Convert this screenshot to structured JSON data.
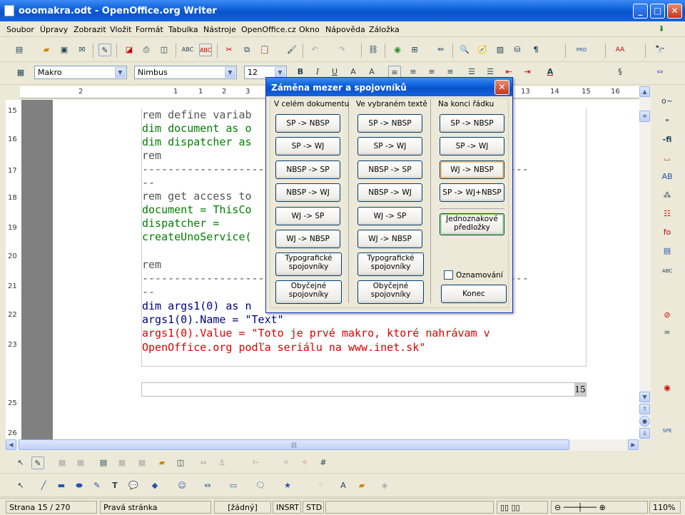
{
  "window": {
    "title": "ooomakra.odt - OpenOffice.org Writer"
  },
  "menu": [
    "Soubor",
    "Úpravy",
    "Zobrazit",
    "Vložit",
    "Formát",
    "Tabulka",
    "Nástroje",
    "OpenOffice.cz",
    "Okno",
    "Nápověda",
    "Záložka"
  ],
  "format_bar": {
    "style": "Makro",
    "font": "Nimbus",
    "size": "12"
  },
  "ruler": {
    "h_ticks": [
      "2",
      "1",
      "1",
      "2",
      "3",
      "4",
      "5",
      "13",
      "14",
      "15",
      "16"
    ],
    "v_ticks": [
      "15",
      "16",
      "17",
      "18",
      "19",
      "20",
      "21",
      "22",
      "23",
      "25",
      "26"
    ]
  },
  "document": {
    "lines": [
      {
        "text": "rem define variab",
        "cls": "c-gray"
      },
      {
        "text": "dim document as o",
        "cls": "c-green"
      },
      {
        "text": "dim dispatcher as",
        "cls": "c-green"
      },
      {
        "text": "rem",
        "cls": "c-gray"
      },
      {
        "text": "------------------------------------------------------------",
        "cls": "c-gray"
      },
      {
        "text": "--",
        "cls": "c-gray"
      },
      {
        "text": "rem get access to",
        "cls": "c-gray"
      },
      {
        "text": "document = ThisCo",
        "cls": "c-green"
      },
      {
        "text": "dispatcher =",
        "cls": "c-green"
      },
      {
        "text": "createUnoService(                                    r\")",
        "cls": "c-green"
      },
      {
        "text": "",
        "cls": "c-gray"
      },
      {
        "text": "rem",
        "cls": "c-gray"
      },
      {
        "text": "------------------------------------------------------------",
        "cls": "c-gray"
      },
      {
        "text": "--",
        "cls": "c-gray"
      },
      {
        "text": "dim args1(0) as n                                   ue",
        "cls": "c-navy"
      },
      {
        "text": "args1(0).Name = \"Text\"",
        "cls": "c-navy"
      },
      {
        "text": "args1(0).Value = \"Toto je prvé makro, ktoré nahrávam v",
        "cls": "c-red"
      },
      {
        "text": "OpenOffice.org podľa seriálu na www.inet.sk\"",
        "cls": "c-red"
      }
    ],
    "footer_page_number": "15"
  },
  "dialog": {
    "title": "Záměna mezer a spojovníků",
    "col1_header": "V celém dokumentu",
    "col2_header": "Ve vybraném textě",
    "col3_header": "Na konci řádku",
    "col1": [
      "SP -> NBSP",
      "SP -> WJ",
      "NBSP -> SP",
      "NBSP -> WJ",
      "WJ -> SP",
      "WJ -> NBSP",
      "Typografické spojovníky",
      "Obyčejné spojovníky"
    ],
    "col2": [
      "SP -> NBSP",
      "SP -> WJ",
      "NBSP -> SP",
      "NBSP -> WJ",
      "WJ -> SP",
      "WJ -> NBSP",
      "Typografické spojovníky",
      "Obyčejné spojovníky"
    ],
    "col3": [
      "SP -> NBSP",
      "SP -> WJ",
      "WJ -> NBSP",
      "SP -> WJ+NBSP"
    ],
    "unique_templates": "Jednoznakové předložky",
    "notify_label": "Oznamování",
    "close_label": "Konec"
  },
  "status": {
    "page": "Strana 15 / 270",
    "style": "Pravá stránka",
    "lang": "[žádný]",
    "insert": "INSRT",
    "mode": "STD",
    "zoom": "110%"
  }
}
